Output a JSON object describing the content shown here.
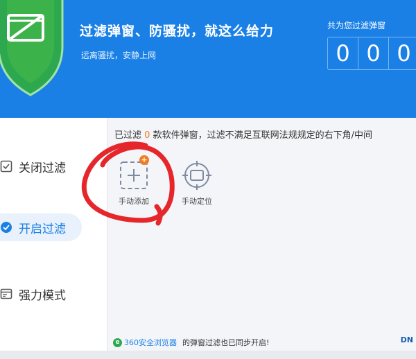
{
  "header": {
    "title": "过滤弹窗、防骚扰，就这么给力",
    "subtitle": "远离骚扰，安静上网",
    "counter_label": "共为您过滤弹窗",
    "counter_digits": [
      "0",
      "0",
      "0"
    ]
  },
  "sidebar": {
    "items": [
      {
        "label": "关闭过滤",
        "icon": "checkbox-icon",
        "active": false
      },
      {
        "label": "开启过滤",
        "icon": "check-circle-icon",
        "active": true
      },
      {
        "label": "强力模式",
        "icon": "window-icon",
        "active": false
      }
    ]
  },
  "main": {
    "notice_prefix": "已过滤",
    "notice_count": "0",
    "notice_suffix": "款软件弹窗，过滤不满足互联网法规规定的右下角/中间",
    "tools": [
      {
        "label": "手动添加",
        "icon": "add-square-icon",
        "badge": "+"
      },
      {
        "label": "手动定位",
        "icon": "crosshair-icon"
      }
    ]
  },
  "footer": {
    "browser_name": "360安全浏览器",
    "message": "的弹窗过滤也已同步开启!",
    "corner_text": "DN"
  },
  "colors": {
    "header_blue": "#1a80e6",
    "accent_orange": "#f07c1f",
    "shield_green": "#3bb34a",
    "annotation_red": "#e5262b"
  }
}
